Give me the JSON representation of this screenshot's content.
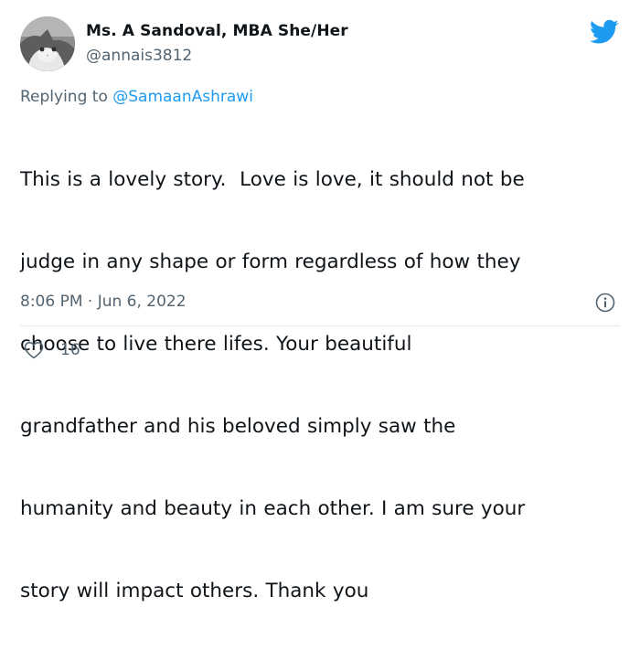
{
  "author": {
    "name": "Ms. A Sandoval, MBA She/Her",
    "handle": "@annais3812",
    "avatar": "cat-photo-avatar"
  },
  "platform_icon": "twitter-bird-icon",
  "reply": {
    "prefix": "Replying to ",
    "mention": "@SamaanAshrawi"
  },
  "tweet": {
    "lines": [
      "This is a lovely story.  Love is love, it should not be",
      "judge in any shape or form regardless of how they",
      "choose to live there lifes. Your beautiful",
      "grandfather and his beloved simply saw the",
      "humanity and beauty in each other. I am sure your",
      "story will impact others. Thank you"
    ],
    "timestamp": "8:06 PM · Jun 6, 2022"
  },
  "actions": {
    "like_icon": "heart-icon",
    "like_count": "16",
    "info_icon": "info-icon"
  },
  "colors": {
    "text_primary": "#0f1419",
    "text_secondary": "#536471",
    "accent": "#1d9bf0",
    "divider": "#e3e8eb"
  }
}
